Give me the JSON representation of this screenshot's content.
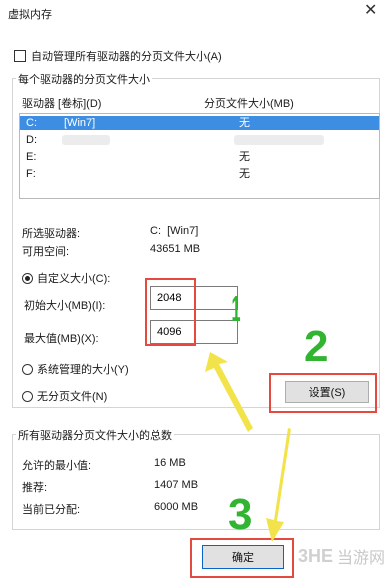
{
  "window": {
    "title": "虚拟内存",
    "close_glyph": "✕"
  },
  "auto_manage": {
    "label": "自动管理所有驱动器的分页文件大小(A)",
    "checked": false
  },
  "per_drive_group": {
    "title": "每个驱动器的分页文件大小",
    "col_drive": "驱动器 [卷标](D)",
    "col_size": "分页文件大小(MB)",
    "drives": [
      {
        "drive": "C:",
        "label": "[Win7]",
        "size": "无",
        "selected": true
      },
      {
        "drive": "D:",
        "label": "",
        "size": "",
        "selected": false
      },
      {
        "drive": "E:",
        "label": "",
        "size": "无",
        "selected": false
      },
      {
        "drive": "F:",
        "label": "",
        "size": "无",
        "selected": false
      }
    ],
    "selected_drive_label": "所选驱动器:",
    "selected_drive_value": "C:  [Win7]",
    "free_space_label": "可用空间:",
    "free_space_value": "43651 MB",
    "custom_size_label": "自定义大小(C):",
    "initial_label": "初始大小(MB)(I):",
    "initial_value": "2048",
    "max_label": "最大值(MB)(X):",
    "max_value": "4096",
    "system_managed_label": "系统管理的大小(Y)",
    "no_paging_label": "无分页文件(N)",
    "set_button": "设置(S)",
    "selected_option": "custom"
  },
  "totals_group": {
    "title": "所有驱动器分页文件大小的总数",
    "min_label": "允许的最小值:",
    "min_value": "16 MB",
    "recommended_label": "推荐:",
    "recommended_value": "1407 MB",
    "current_label": "当前已分配:",
    "current_value": "6000 MB"
  },
  "ok_button": "确定",
  "annotations": {
    "one": "1",
    "two": "2",
    "three": "3"
  },
  "watermark": {
    "logo": "3HE",
    "text": "当游网"
  },
  "colors": {
    "selection": "#3d8ee3",
    "red_box": "#e54a40",
    "annotation_green": "#31b431",
    "arrow_yellow": "#f2e34a"
  }
}
